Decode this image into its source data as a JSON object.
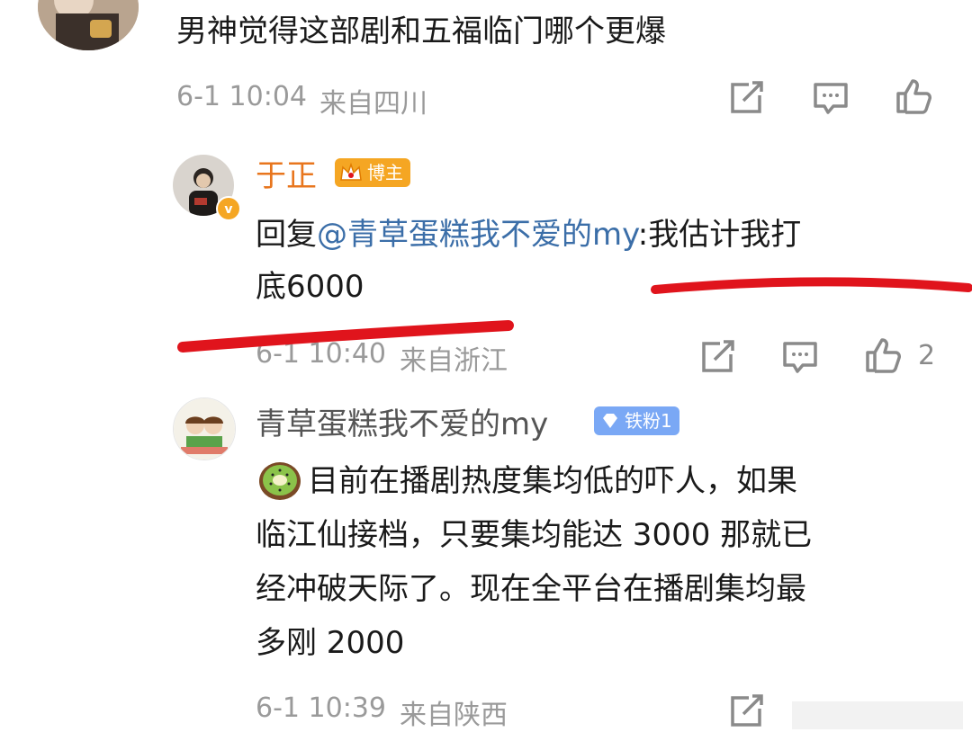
{
  "comment_top": {
    "text": "男神觉得这部剧和五福临门哪个更爆",
    "time": "6-1 10:04",
    "location": "来自四川"
  },
  "reply_host": {
    "username": "于正",
    "badge": "博主",
    "reply_prefix": "回复",
    "mention": "@青草蛋糕我不爱的my",
    "text_line1": ":我估计我打",
    "text_line2": "底6000",
    "time": "6-1 10:40",
    "location": "来自浙江",
    "likes": "2"
  },
  "reply_fan": {
    "username": "青草蛋糕我不爱的my",
    "badge": "铁粉1",
    "lines": [
      "目前在播剧热度集均低的吓人，如果",
      "临江仙接档，只要集均能达 3000 那就已",
      "经冲破天际了。现在全平台在播剧集均最",
      "多刚 2000"
    ],
    "time": "6-1 10:39",
    "location": "来自陕西"
  },
  "colors": {
    "host_name": "#e8761e",
    "mention": "#3b6ea8",
    "meta": "#9a9a9a",
    "red_underline": "#e0141c"
  },
  "icons": [
    "repost-icon",
    "comment-icon",
    "like-icon",
    "kiwi-emoji-icon",
    "crown-icon",
    "diamond-icon",
    "verified-icon"
  ]
}
